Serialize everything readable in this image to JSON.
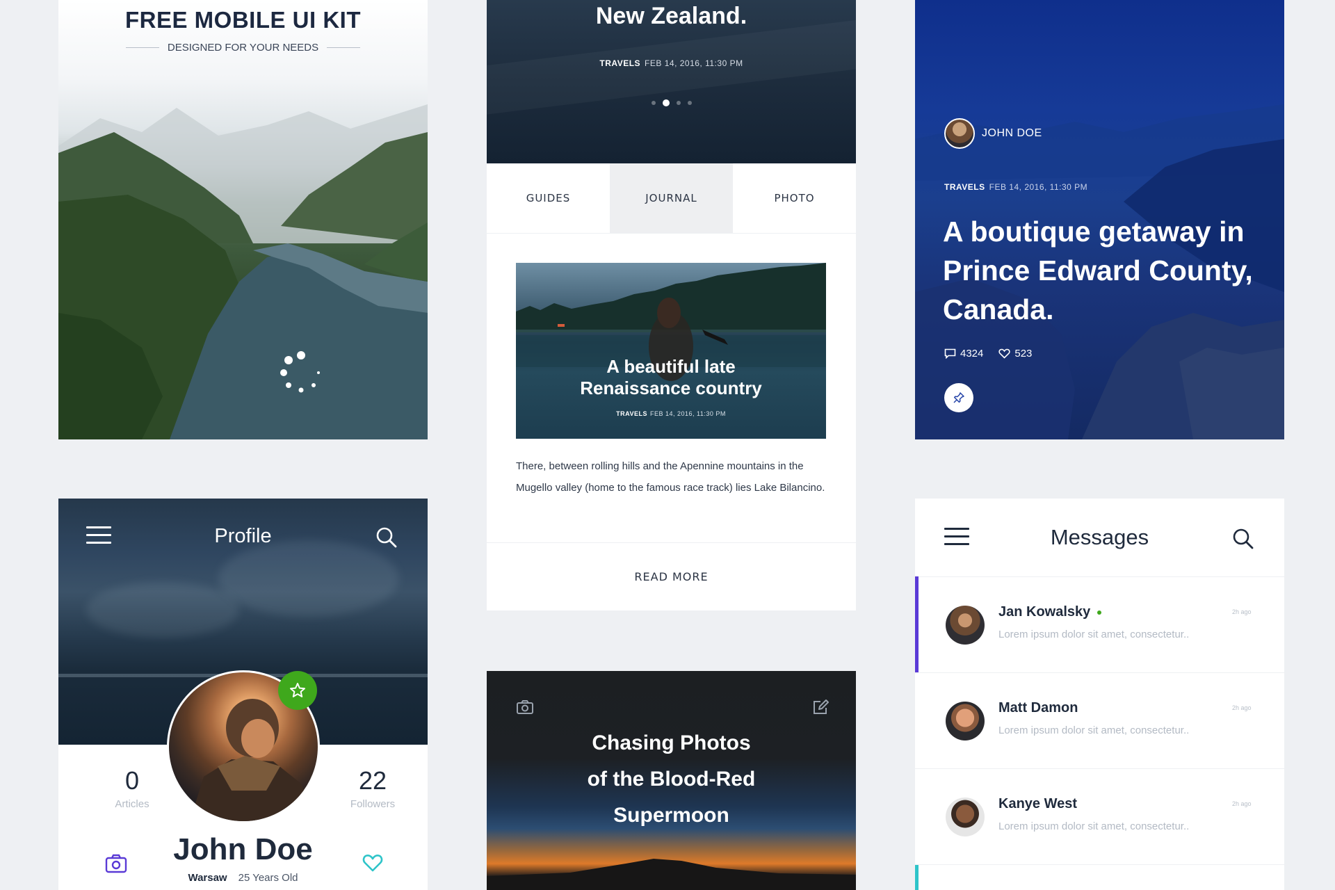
{
  "splash": {
    "title": "FREE MOBILE UI KIT",
    "subtitle": "DESIGNED FOR YOUR NEEDS"
  },
  "journal": {
    "hero_title": "New Zealand.",
    "hero_category": "TRAVELS",
    "hero_date": "FEB 14, 2016, 11:30 PM",
    "slides_total": 4,
    "slide_active": 2,
    "tabs": [
      {
        "label": "GUIDES"
      },
      {
        "label": "JOURNAL"
      },
      {
        "label": "PHOTO"
      }
    ],
    "active_tab": "JOURNAL",
    "feature_title_line1": "A beautiful late",
    "feature_title_line2": "Renaissance country",
    "feature_category": "TRAVELS",
    "feature_date": "FEB 14, 2016, 11:30 PM",
    "body": "There, between rolling hills and the Apennine mountains in the Mugello valley (home to the famous race track) lies Lake Bilancino.",
    "read_more": "READ MORE"
  },
  "canada": {
    "author": "JOHN DOE",
    "category": "TRAVELS",
    "date": "FEB 14, 2016, 11:30 PM",
    "headline": "A boutique getaway in Prince Edward County, Canada.",
    "comments": "4324",
    "likes": "523"
  },
  "profile": {
    "title": "Profile",
    "articles_count": "0",
    "articles_label": "Articles",
    "followers_count": "22",
    "followers_label": "Followers",
    "name": "John Doe",
    "city": "Warsaw",
    "age": "25 Years Old"
  },
  "moon": {
    "title_line1": "Chasing Photos",
    "title_line2": "of the Blood-Red",
    "title_line3": "Supermoon"
  },
  "messages": {
    "title": "Messages",
    "items": [
      {
        "name": "Jan Kowalsky",
        "preview": "Lorem ipsum dolor sit amet, consectetur..",
        "time": "2h ago",
        "online": true,
        "accent": "#5a3ad6"
      },
      {
        "name": "Matt Damon",
        "preview": "Lorem ipsum dolor sit amet, consectetur..",
        "time": "2h ago",
        "online": false,
        "accent": ""
      },
      {
        "name": "Kanye West",
        "preview": "Lorem ipsum dolor sit amet, consectetur..",
        "time": "2h ago",
        "online": false,
        "accent": ""
      }
    ],
    "next_accent": "#2ec4c9"
  },
  "colors": {
    "navy_text": "#1f2a3c",
    "green_badge": "#3fa81c",
    "purple_icon": "#5a3ad6",
    "teal_icon": "#2ec4c9",
    "canada_blue": "#163a97"
  }
}
